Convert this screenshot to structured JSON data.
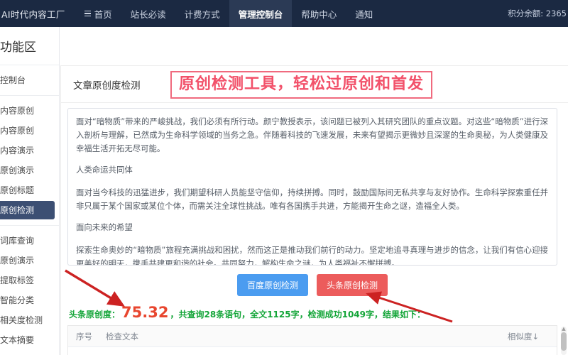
{
  "topnav": {
    "brand": "AI时代内容工厂",
    "menu_icon": "hamburger-icon",
    "items": [
      {
        "label": "首页",
        "active": false,
        "has_icon": true
      },
      {
        "label": "站长必读",
        "active": false,
        "has_icon": false
      },
      {
        "label": "计费方式",
        "active": false,
        "has_icon": false
      },
      {
        "label": "管理控制台",
        "active": true,
        "has_icon": false
      },
      {
        "label": "帮助中心",
        "active": false,
        "has_icon": false
      },
      {
        "label": "通知",
        "active": false,
        "has_icon": false
      }
    ],
    "credit_label": "积分余额: 2365",
    "bg_color": "#1b2942",
    "active_bg_color": "#2b3a55"
  },
  "sidebar": {
    "title": "功能区",
    "groups": [
      {
        "items": [
          {
            "label": "控制台",
            "active": false
          }
        ]
      },
      {
        "items": [
          {
            "label": "内容原创",
            "active": false
          },
          {
            "label": "内容原创",
            "active": false
          },
          {
            "label": "内容演示",
            "active": false
          },
          {
            "label": "原创演示",
            "active": false
          },
          {
            "label": "原创标题",
            "active": false
          },
          {
            "label": "原创检测",
            "active": true
          }
        ]
      },
      {
        "items": [
          {
            "label": "词库查询",
            "active": false
          },
          {
            "label": "原创演示",
            "active": false
          },
          {
            "label": "提取标签",
            "active": false
          },
          {
            "label": "智能分类",
            "active": false
          },
          {
            "label": "相关度检测",
            "active": false
          },
          {
            "label": "文本摘要",
            "active": false
          }
        ]
      }
    ],
    "active_bg_color": "#3c4f73"
  },
  "panel": {
    "title": "文章原创度检测",
    "annotation": "原创检测工具，轻松过原创和首发",
    "annotation_color": "#f2516a"
  },
  "editor": {
    "paragraphs": [
      "面对“暗物质”带来的严峻挑战，我们必须有所行动。颜宁教授表示，该问题已被列入其研究团队的重点议题。对这些“暗物质”进行深入剖析与理解，已然成为生命科学领域的当务之急。伴随着科技的飞速发展，未来有望揭示更微妙且深邃的生命奥秘，为人类健康及幸福生活开拓无尽可能。",
      "人类命运共同体",
      "面对当今科技的迅猛进步，我们期望科研人员能坚守信仰，持续拼搏。同时，鼓励国际间无私共享与友好协作。生命科学探索重任并非只属于某个国家或某位个体，而需关注全球性挑战。唯有各国携手共进，方能揭开生命之谜，造福全人类。",
      "面向未来的希望",
      "探索生命奥妙的“暗物质”旅程充满挑战和困扰，然而这正是推动我们前行的动力。坚定地追寻真理与进步的信念，让我们有信心迎接更美好的明天，携手共建更和谐的社会。共同努力，解构生命之谜，为人类福祉不懈拼搏。"
    ]
  },
  "buttons": {
    "baidu": {
      "label": "百度原创检测",
      "color": "#4b9cf0"
    },
    "toutiao": {
      "label": "头条原创检测",
      "color": "#ec5c5c"
    }
  },
  "result": {
    "prefix": "头条原创度：",
    "score": "75.32",
    "seg_a": "，共查询",
    "count_sentences": "28",
    "seg_b": "条语句，全文",
    "total_chars": "1125",
    "seg_c": "字，检测成功",
    "ok_chars": "1049",
    "seg_d": "字，结果如下：",
    "label_color": "#13a538",
    "score_color": "#e8462f"
  },
  "table": {
    "headers": {
      "no": "序号",
      "text": "检查文本",
      "similarity": "相似度↓"
    }
  },
  "annotations": {
    "arrow_to_score": "arrow-icon",
    "arrow_to_toutiao_button": "arrow-icon",
    "arrow_color": "#cc2222"
  }
}
